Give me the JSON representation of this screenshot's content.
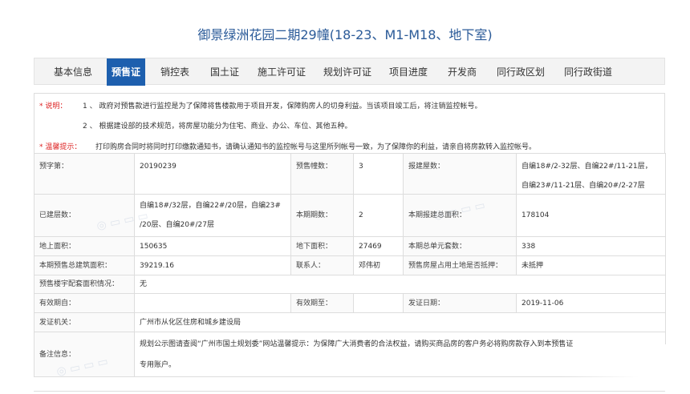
{
  "title": "御景绿洲花园二期29幢(18-23、M1-M18、地下室)",
  "tabs": [
    {
      "label": "基本信息",
      "active": false
    },
    {
      "label": "预售证",
      "active": true
    },
    {
      "label": "销控表",
      "active": false
    },
    {
      "label": "国土证",
      "active": false
    },
    {
      "label": "施工许可证",
      "active": false
    },
    {
      "label": "规划许可证",
      "active": false
    },
    {
      "label": "项目进度",
      "active": false
    },
    {
      "label": "开发商",
      "active": false
    },
    {
      "label": "同行政区划",
      "active": false
    },
    {
      "label": "同行政街道",
      "active": false
    }
  ],
  "notes": {
    "explain_label": "* 说明：",
    "item1": "1 、 政府对预售款进行监控是为了保障将售楼款用于项目开发，保障购房人的切身利益。当该项目竣工后，将注销监控帐号。",
    "item2": "2 、 根据建设部的技术规范，将房屋功能分为住宅、商业、办公、车位、其他五种。",
    "tip_label": "* 温馨提示：",
    "tip": "打印购房合同时将同时打印缴款通知书，请确认通知书的监控帐号与这里所列帐号一致，为了保障你的利益，请亲自将房款转入监控帐号。"
  },
  "info": {
    "presale_no_label": "预字第：",
    "presale_no": "20190239",
    "buildings_label": "预售幢数：",
    "buildings": "3",
    "floors_reported_label": "报建屋数：",
    "floors_reported_1": "自编18#/2-32层、自编22#/11-21层，",
    "floors_reported_2": "自编23#/11-21层、自编20#/2-27层",
    "built_floors_label": "已建层数：",
    "built_floors_1": "自编18#/32层，自编22#/20层，自编23#",
    "built_floors_2": "/20层、自编20#/27层",
    "phase_label": "本期期数：",
    "phase": "2",
    "total_area_label": "本期报建总面积：",
    "total_area": "178104",
    "above_area_label": "地上面积：",
    "above_area": "150635",
    "under_area_label": "地下面积：",
    "under_area": "27469",
    "units_label": "本期总单元套数：",
    "units": "338",
    "presale_area_label": "本期预售总建筑面积：",
    "presale_area": "39219.16",
    "contact_label": "联系人：",
    "contact": "邓伟初",
    "mortgage_label": "预售房屋占用土地是否抵押：",
    "mortgage": "未抵押",
    "ancillary_label": "预售楼宇配套面积情况：",
    "ancillary": "无",
    "valid_from_label": "有效期自：",
    "valid_from": "",
    "valid_to_label": "有效期至：",
    "valid_to": "",
    "issue_date_label": "发证日期：",
    "issue_date": "2019-11-06",
    "authority_label": "发证机关：",
    "authority": "广州市从化区住房和城乡建设局",
    "remark_label": "备注信息：",
    "remark_1": "规划公示图请查阅“广州市国土规划委”网站温馨提示：为保障广大消费者的合法权益，请购买商品房的客户务必将购房款存入到本预售证",
    "remark_2": "专用账户。"
  },
  "colors": {
    "accent": "#1d5fae",
    "title": "#2a5a98",
    "warning": "#dd2222"
  }
}
